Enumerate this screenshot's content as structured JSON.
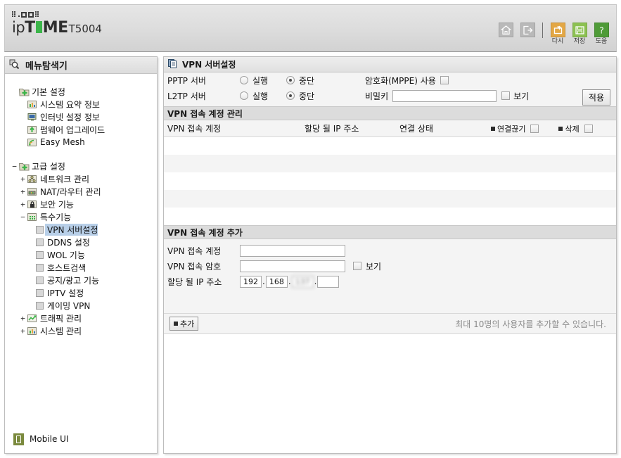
{
  "header": {
    "brand_prefix": "ip",
    "brand_t": "T",
    "brand_me": "ME",
    "model": "T5004",
    "icons": [
      {
        "name": "home-icon",
        "label": "",
        "style": "gray"
      },
      {
        "name": "logout-icon",
        "label": "",
        "style": "gray"
      },
      {
        "name": "restart-icon",
        "label": "다시",
        "style": "orange"
      },
      {
        "name": "save-icon",
        "label": "저장",
        "style": "green"
      },
      {
        "name": "help-icon",
        "label": "도움",
        "style": "dgreen"
      }
    ]
  },
  "sidebar": {
    "title": "메뉴탐색기",
    "tree": [
      {
        "label": "기본 설정",
        "level": 0,
        "toggle": "",
        "icon": "folder-plus-icon",
        "selected": false
      },
      {
        "label": "시스템 요약 정보",
        "level": 1,
        "toggle": "",
        "icon": "chart-icon",
        "selected": false
      },
      {
        "label": "인터넷 설정 정보",
        "level": 1,
        "toggle": "",
        "icon": "monitor-icon",
        "selected": false
      },
      {
        "label": "펌웨어 업그레이드",
        "level": 1,
        "toggle": "",
        "icon": "upload-icon",
        "selected": false
      },
      {
        "label": "Easy Mesh",
        "level": 1,
        "toggle": "",
        "icon": "wifi-icon",
        "selected": false
      },
      {
        "label": "고급 설정",
        "level": 0,
        "toggle": "−",
        "icon": "folder-plus-icon",
        "selected": false
      },
      {
        "label": "네트워크 관리",
        "level": 1,
        "toggle": "+",
        "icon": "network-icon",
        "selected": false
      },
      {
        "label": "NAT/라우터 관리",
        "level": 1,
        "toggle": "+",
        "icon": "router-icon",
        "selected": false
      },
      {
        "label": "보안 기능",
        "level": 1,
        "toggle": "+",
        "icon": "lock-icon",
        "selected": false
      },
      {
        "label": "특수기능",
        "level": 1,
        "toggle": "−",
        "icon": "grid-icon",
        "selected": false
      },
      {
        "label": "VPN 서버설정",
        "level": 2,
        "toggle": "",
        "icon": "leaf-icon",
        "selected": true
      },
      {
        "label": "DDNS 설정",
        "level": 2,
        "toggle": "",
        "icon": "leaf-icon",
        "selected": false
      },
      {
        "label": "WOL 기능",
        "level": 2,
        "toggle": "",
        "icon": "leaf-icon",
        "selected": false
      },
      {
        "label": "호스트검색",
        "level": 2,
        "toggle": "",
        "icon": "leaf-icon",
        "selected": false
      },
      {
        "label": "공지/광고 기능",
        "level": 2,
        "toggle": "",
        "icon": "leaf-icon",
        "selected": false
      },
      {
        "label": "IPTV 설정",
        "level": 2,
        "toggle": "",
        "icon": "leaf-icon",
        "selected": false
      },
      {
        "label": "게이밍 VPN",
        "level": 2,
        "toggle": "",
        "icon": "leaf-icon",
        "selected": false
      },
      {
        "label": "트래픽 관리",
        "level": 1,
        "toggle": "+",
        "icon": "traffic-icon",
        "selected": false
      },
      {
        "label": "시스템 관리",
        "level": 1,
        "toggle": "+",
        "icon": "chart-icon",
        "selected": false
      }
    ],
    "mobile_ui": "Mobile UI"
  },
  "panel": {
    "title": "VPN 서버설정",
    "server_settings": {
      "pptp_label": "PPTP 서버",
      "l2tp_label": "L2TP 서버",
      "run_label": "실행",
      "stop_label": "중단",
      "pptp_value": "중단",
      "l2tp_value": "중단",
      "mppe_label": "암호화(MPPE) 사용",
      "mppe_checked": false,
      "secret_label": "비밀키",
      "secret_value": "",
      "show_label": "보기",
      "show_checked": false,
      "apply_label": "적용"
    },
    "account_manage": {
      "section_title": "VPN 접속 계정 관리",
      "columns": [
        "VPN 접속 계정",
        "할당 될 IP 주소",
        "연결 상태"
      ],
      "disconnect_label": "연결끊기",
      "delete_label": "삭제",
      "disconnect_checked": false,
      "delete_checked": false,
      "rows": []
    },
    "account_add": {
      "section_title": "VPN 접속 계정 추가",
      "account_label": "VPN 접속 계정",
      "account_value": "",
      "password_label": "VPN 접속 암호",
      "password_value": "",
      "show_label": "보기",
      "show_checked": false,
      "ip_label": "할당 될 IP 주소",
      "ip_octet1": "192",
      "ip_octet2": "168",
      "ip_octet3": "137",
      "ip_octet4": "",
      "add_label": "추가",
      "hint": "최대 10명의 사용자를 추가할 수 있습니다."
    }
  }
}
